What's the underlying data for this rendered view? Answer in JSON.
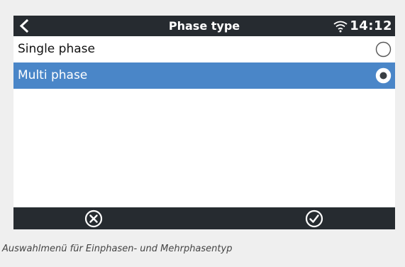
{
  "header": {
    "title": "Phase type",
    "time": "14:12"
  },
  "options": [
    {
      "label": "Single phase",
      "selected": false
    },
    {
      "label": "Multi phase",
      "selected": true
    }
  ],
  "footer": {
    "cancel_icon": "circle-x-icon",
    "confirm_icon": "circle-check-icon"
  },
  "caption": "Auswahlmenü für Einphasen- und Mehrphasentyp",
  "colors": {
    "header_bg": "#262b30",
    "selected_bg": "#4a86c8",
    "text_on_dark": "#ffffff"
  }
}
